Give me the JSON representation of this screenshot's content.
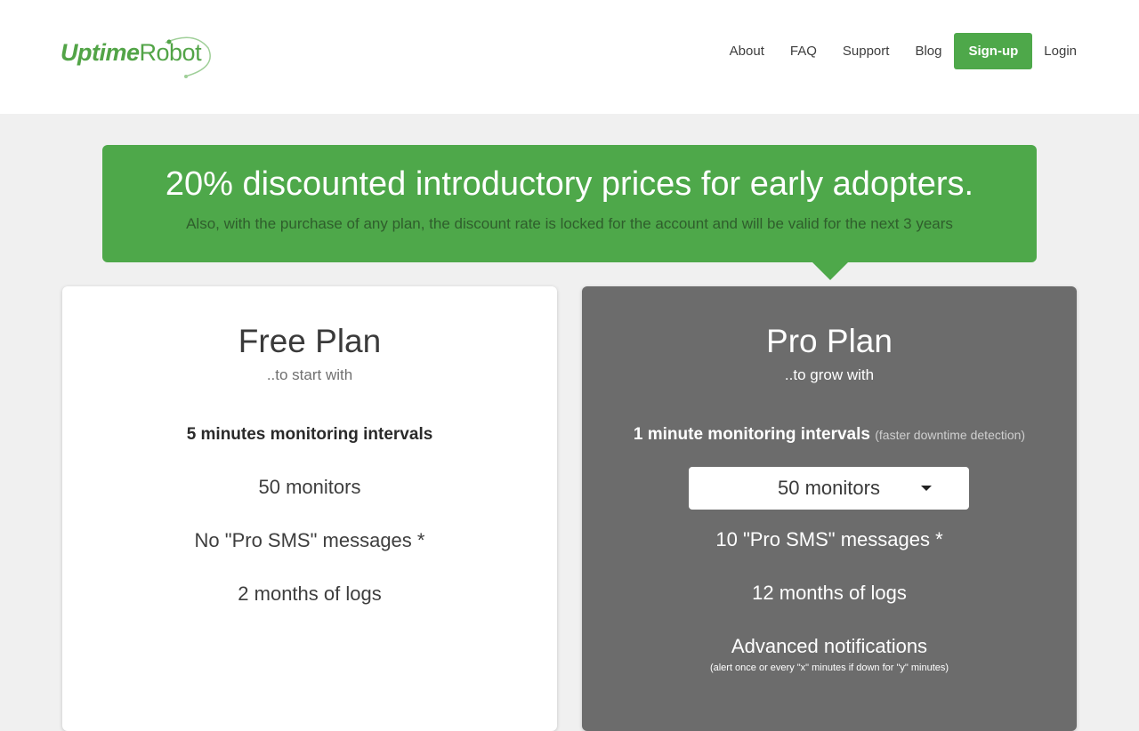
{
  "header": {
    "logo": {
      "text_bold": "Uptime",
      "text_light": "Robot"
    },
    "nav": [
      {
        "label": "About"
      },
      {
        "label": "FAQ"
      },
      {
        "label": "Support"
      },
      {
        "label": "Blog"
      },
      {
        "label": "Sign-up"
      },
      {
        "label": "Login"
      }
    ]
  },
  "banner": {
    "title": "20% discounted introductory prices for early adopters.",
    "subtitle": "Also, with the purchase of any plan, the discount rate is locked for the account and will be valid for the next 3 years"
  },
  "plans": {
    "free": {
      "title": "Free Plan",
      "subtitle": "..to start with",
      "interval": "5 minutes monitoring intervals",
      "monitors": "50 monitors",
      "sms": "No \"Pro SMS\" messages *",
      "logs": "2 months of logs"
    },
    "pro": {
      "title": "Pro Plan",
      "subtitle": "..to grow with",
      "interval": "1 minute monitoring intervals",
      "interval_note": "(faster downtime detection)",
      "monitors_select": "50 monitors",
      "sms": "10 \"Pro SMS\" messages *",
      "logs": "12 months of logs",
      "notifications": "Advanced notifications",
      "notifications_note": "(alert once or every \"x\" minutes if down for \"y\" minutes)"
    }
  },
  "colors": {
    "brand_green": "#4ea84a",
    "pro_card_bg": "#6c6c6c",
    "page_bg": "#f0f0f0"
  }
}
